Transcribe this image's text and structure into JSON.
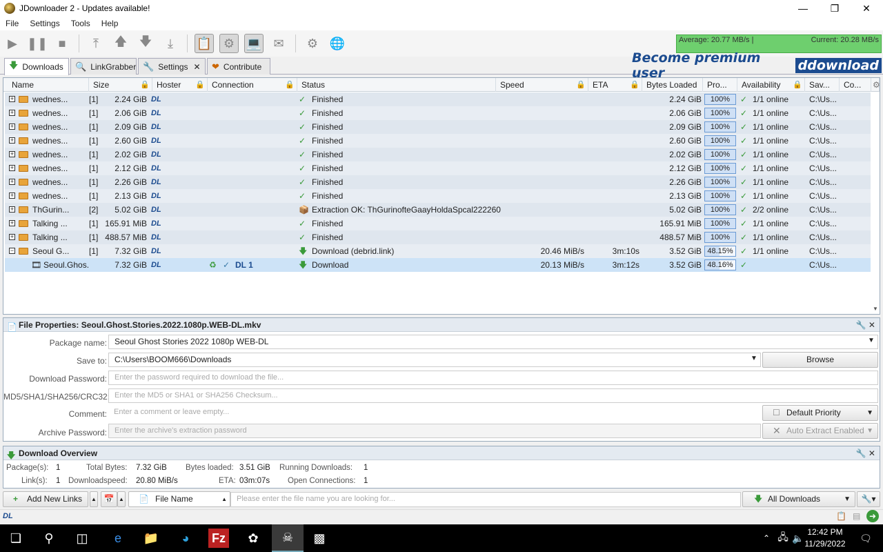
{
  "window": {
    "title": "JDownloader 2 - Updates available!"
  },
  "menu": [
    "File",
    "Settings",
    "Tools",
    "Help"
  ],
  "speed": {
    "average": "Average: 20.77 MB/s |",
    "current": "Current: 20.28 MB/s"
  },
  "tabs": [
    {
      "label": "Downloads"
    },
    {
      "label": "LinkGrabber"
    },
    {
      "label": "Settings"
    },
    {
      "label": "Contribute"
    }
  ],
  "premium": {
    "text": "Become premium user",
    "logo": "ddownload"
  },
  "columns": [
    "Name",
    "Size",
    "Hoster",
    "Connection",
    "Status",
    "Speed",
    "ETA",
    "Bytes Loaded",
    "Pro...",
    "Availability",
    "Sav...",
    "Co..."
  ],
  "rows": [
    {
      "name": "wednes...",
      "count": "[1]",
      "size": "2.24 GiB",
      "hoster": "DL",
      "conn": "",
      "status": "Finished",
      "speed": "",
      "eta": "",
      "bytes": "2.24 GiB",
      "prog": "100%",
      "avail": "1/1 online",
      "save": "C:\\Us..."
    },
    {
      "name": "wednes...",
      "count": "[1]",
      "size": "2.06 GiB",
      "hoster": "DL",
      "conn": "",
      "status": "Finished",
      "speed": "",
      "eta": "",
      "bytes": "2.06 GiB",
      "prog": "100%",
      "avail": "1/1 online",
      "save": "C:\\Us..."
    },
    {
      "name": "wednes...",
      "count": "[1]",
      "size": "2.09 GiB",
      "hoster": "DL",
      "conn": "",
      "status": "Finished",
      "speed": "",
      "eta": "",
      "bytes": "2.09 GiB",
      "prog": "100%",
      "avail": "1/1 online",
      "save": "C:\\Us..."
    },
    {
      "name": "wednes...",
      "count": "[1]",
      "size": "2.60 GiB",
      "hoster": "DL",
      "conn": "",
      "status": "Finished",
      "speed": "",
      "eta": "",
      "bytes": "2.60 GiB",
      "prog": "100%",
      "avail": "1/1 online",
      "save": "C:\\Us..."
    },
    {
      "name": "wednes...",
      "count": "[1]",
      "size": "2.02 GiB",
      "hoster": "DL",
      "conn": "",
      "status": "Finished",
      "speed": "",
      "eta": "",
      "bytes": "2.02 GiB",
      "prog": "100%",
      "avail": "1/1 online",
      "save": "C:\\Us..."
    },
    {
      "name": "wednes...",
      "count": "[1]",
      "size": "2.12 GiB",
      "hoster": "DL",
      "conn": "",
      "status": "Finished",
      "speed": "",
      "eta": "",
      "bytes": "2.12 GiB",
      "prog": "100%",
      "avail": "1/1 online",
      "save": "C:\\Us..."
    },
    {
      "name": "wednes...",
      "count": "[1]",
      "size": "2.26 GiB",
      "hoster": "DL",
      "conn": "",
      "status": "Finished",
      "speed": "",
      "eta": "",
      "bytes": "2.26 GiB",
      "prog": "100%",
      "avail": "1/1 online",
      "save": "C:\\Us..."
    },
    {
      "name": "wednes...",
      "count": "[1]",
      "size": "2.13 GiB",
      "hoster": "DL",
      "conn": "",
      "status": "Finished",
      "speed": "",
      "eta": "",
      "bytes": "2.13 GiB",
      "prog": "100%",
      "avail": "1/1 online",
      "save": "C:\\Us..."
    },
    {
      "name": "ThGurin...",
      "count": "[2]",
      "size": "5.02 GiB",
      "hoster": "DL",
      "conn": "",
      "status": "Extraction OK: ThGurinofteGaayHoldaSpcal222260...",
      "speed": "",
      "eta": "",
      "bytes": "5.02 GiB",
      "prog": "100%",
      "avail": "2/2 online",
      "save": "C:\\Us..."
    },
    {
      "name": "Talking ...",
      "count": "[1]",
      "size": "165.91 MiB",
      "hoster": "DL",
      "conn": "",
      "status": "Finished",
      "speed": "",
      "eta": "",
      "bytes": "165.91 MiB",
      "prog": "100%",
      "avail": "1/1 online",
      "save": "C:\\Us..."
    },
    {
      "name": "Talking ...",
      "count": "[1]",
      "size": "488.57 MiB",
      "hoster": "DL",
      "conn": "",
      "status": "Finished",
      "speed": "",
      "eta": "",
      "bytes": "488.57 MiB",
      "prog": "100%",
      "avail": "1/1 online",
      "save": "C:\\Us..."
    },
    {
      "name": "Seoul G...",
      "count": "[1]",
      "size": "7.32 GiB",
      "hoster": "DL",
      "conn": "",
      "status": "Download (debrid.link)",
      "speed": "20.46 MiB/s",
      "eta": "3m:10s",
      "bytes": "3.52 GiB",
      "prog": "48.15%",
      "avail": "1/1 online",
      "save": "C:\\Us..."
    },
    {
      "name": "Seoul.Ghos.",
      "count": "",
      "size": "7.32 GiB",
      "hoster": "DL",
      "conn": "DL 1",
      "status": "Download",
      "speed": "20.13 MiB/s",
      "eta": "3m:12s",
      "bytes": "3.52 GiB",
      "prog": "48.16%",
      "avail": "",
      "save": "C:\\Us..."
    }
  ],
  "props": {
    "title": "File Properties: Seoul.Ghost.Stories.2022.1080p.WEB-DL.mkv",
    "package_label": "Package name:",
    "package_value": "Seoul Ghost Stories 2022 1080p WEB-DL",
    "save_label": "Save to:",
    "save_value": "C:\\Users\\BOOM666\\Downloads",
    "browse": "Browse",
    "pw_label": "Download Password:",
    "pw_ph": "Enter the password required to download the file...",
    "md5_label": "MD5/SHA1/SHA256/CRC32:",
    "md5_ph": "Enter the MD5 or SHA1 or SHA256 Checksum...",
    "comment_label": "Comment:",
    "comment_ph": "Enter a comment or leave empty...",
    "priority": "Default Priority",
    "archive_label": "Archive Password:",
    "archive_ph": "Enter the archive's extraction password",
    "extract": "Auto Extract Enabled"
  },
  "overview": {
    "title": "Download Overview",
    "packages_label": "Package(s):",
    "packages": "1",
    "total_label": "Total Bytes:",
    "total": "7.32 GiB",
    "loaded_label": "Bytes loaded:",
    "loaded": "3.51 GiB",
    "running_label": "Running Downloads:",
    "running": "1",
    "links_label": "Link(s):",
    "links": "1",
    "dlspeed_label": "Downloadspeed:",
    "dlspeed": "20.80 MiB/s",
    "eta_label": "ETA:",
    "eta": "03m:07s",
    "conn_label": "Open Connections:",
    "conn": "1"
  },
  "bottom": {
    "add": "Add New Links",
    "filter": "File Name",
    "search_ph": "Please enter the file name you are looking for...",
    "all": "All Downloads"
  },
  "status_left": "DL",
  "clock": {
    "time": "12:42 PM",
    "date": "11/29/2022"
  }
}
